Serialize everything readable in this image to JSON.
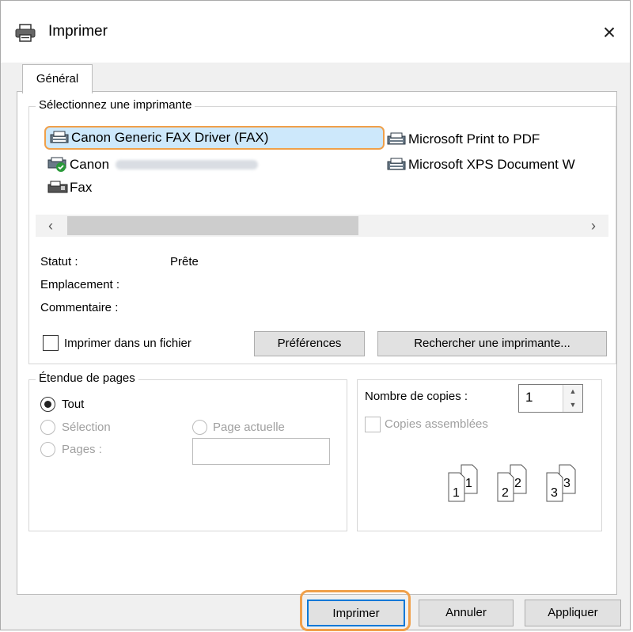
{
  "window": {
    "title": "Imprimer",
    "close_glyph": "×",
    "icon": "printer-icon"
  },
  "tabs": [
    {
      "label": "Général"
    }
  ],
  "printer_group": {
    "legend": "Sélectionnez une imprimante",
    "printers": [
      {
        "name": "Canon Generic FAX Driver (FAX)",
        "icon": "fax-printer-icon",
        "selected": true
      },
      {
        "name": "Canon",
        "icon": "default-printer-icon",
        "name_obscured": true
      },
      {
        "name": "Fax",
        "icon": "fax-icon"
      },
      {
        "name": "Microsoft Print to PDF",
        "icon": "printer-icon"
      },
      {
        "name": "Microsoft XPS Document W",
        "icon": "printer-icon"
      }
    ],
    "scroll_left": "‹",
    "scroll_right": "›",
    "status_label": "Statut :",
    "status_value": "Prête",
    "location_label": "Emplacement :",
    "comment_label": "Commentaire :",
    "print_to_file_label": "Imprimer dans un fichier",
    "print_to_file_checked": false,
    "preferences_label": "Préférences",
    "find_printer_label": "Rechercher une imprimante..."
  },
  "page_range": {
    "legend": "Étendue de pages",
    "all_label": "Tout",
    "selection_label": "Sélection",
    "current_page_label": "Page actuelle",
    "pages_label": "Pages :",
    "selected_option": "Tout"
  },
  "copies": {
    "count_label": "Nombre de copies :",
    "count_value": "1",
    "collate_label": "Copies assemblées",
    "collate_checked": false,
    "collate_pages": [
      "1",
      "1",
      "2",
      "2",
      "3",
      "3"
    ]
  },
  "buttons": {
    "print": "Imprimer",
    "cancel": "Annuler",
    "apply": "Appliquer"
  },
  "colors": {
    "selection_bg": "#cde8fb",
    "focus_highlight": "#f0a04a",
    "dialog_bg": "#f0f0f0"
  }
}
